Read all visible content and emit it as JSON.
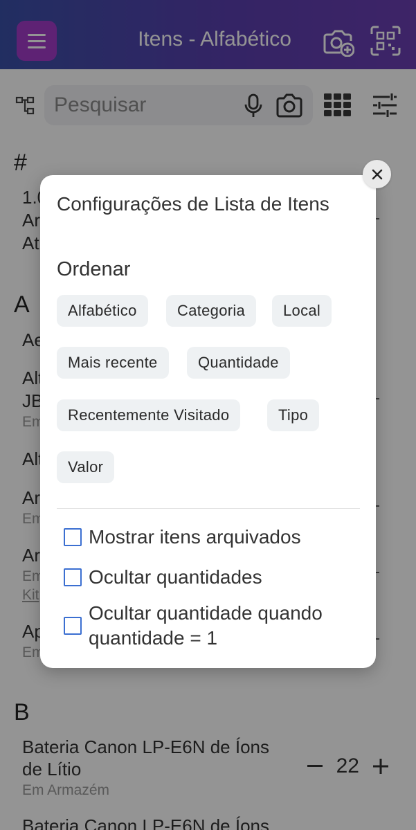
{
  "header": {
    "title": "Itens - Alfabético"
  },
  "search": {
    "placeholder": "Pesquisar"
  },
  "list": {
    "section_hash": "#",
    "hash_item": {
      "line1": "1.0",
      "line2": "Ar",
      "line3": "At"
    },
    "section_a": "A",
    "a_items": [
      {
        "text": "Ae"
      },
      {
        "text": "Alt",
        "text2": "JB",
        "sub": "Em"
      },
      {
        "text": "Alt"
      },
      {
        "text": "Ar",
        "sub": "Em"
      },
      {
        "text": "Ar",
        "sub": "Em",
        "link": "Kit"
      },
      {
        "text": "Ap",
        "sub": "Em"
      }
    ],
    "section_b": "B",
    "b_items": [
      {
        "name_line1": "Bateria Canon LP-E6N de Íons",
        "name_line2": "de Lítio",
        "status": "Em Armazém",
        "qty": "22"
      },
      {
        "name_line1": "Bateria Canon LP-E6N de Íons"
      }
    ]
  },
  "dialog": {
    "title": "Configurações de Lista de Itens",
    "sort_heading": "Ordenar",
    "sort_options": [
      "Alfabético",
      "Categoria",
      "Local",
      "Mais recente",
      "Quantidade",
      "Recentemente Visitado",
      "Tipo",
      "Valor"
    ],
    "checkboxes": [
      {
        "label": "Mostrar itens arquivados",
        "checked": false
      },
      {
        "label": "Ocultar quantidades",
        "checked": false
      },
      {
        "label": "Ocultar quantidade quando quantidade = 1",
        "checked": false
      }
    ]
  },
  "colors": {
    "accent": "#3b6fd1",
    "menu_button": "#a23cc8"
  }
}
